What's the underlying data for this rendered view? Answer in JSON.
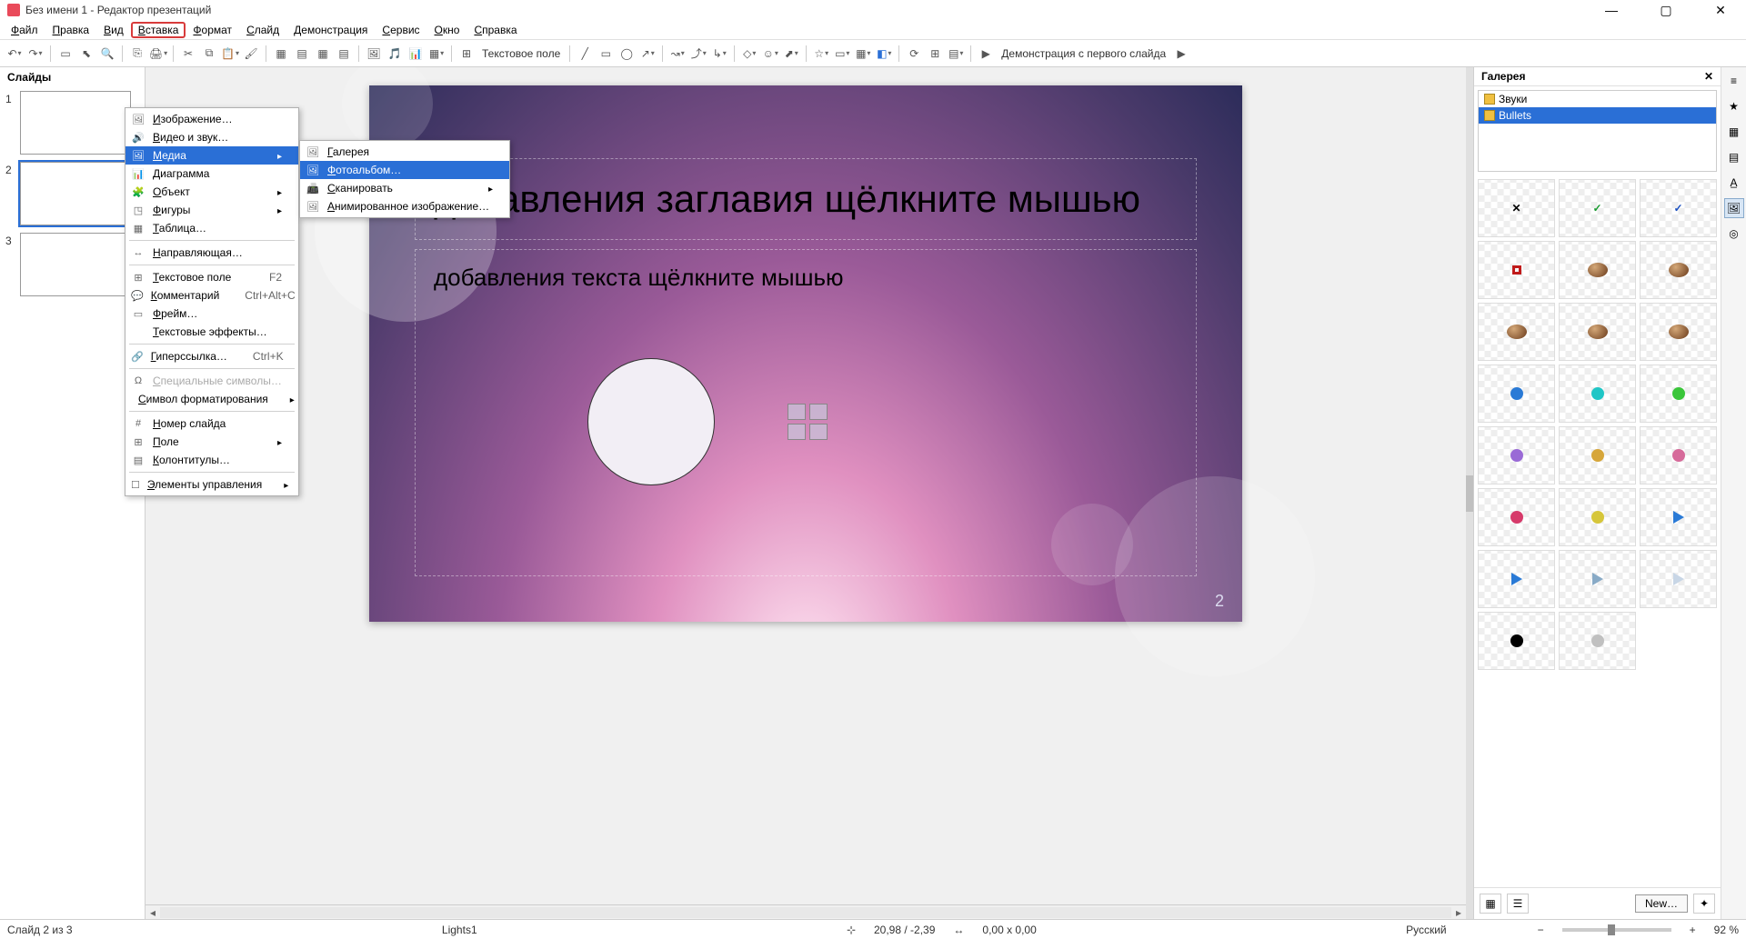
{
  "title": "Без имени 1 - Редактор презентаций",
  "menubar": [
    "Файл",
    "Правка",
    "Вид",
    "Вставка",
    "Формат",
    "Слайд",
    "Демонстрация",
    "Сервис",
    "Окно",
    "Справка"
  ],
  "menubar_highlight_index": 3,
  "toolbar": {
    "textbox_label": "Текстовое поле",
    "slideshow_label": "Демонстрация с первого слайда"
  },
  "slides_panel": {
    "title": "Слайды",
    "count": 3,
    "selected": 2
  },
  "canvas": {
    "title_placeholder": "добавления заглавия щёлкните мышью",
    "subtitle_placeholder": "добавления текста щёлкните мышью",
    "page_number": "2"
  },
  "insert_menu": [
    {
      "icon": "🖼",
      "label": "Изображение…"
    },
    {
      "icon": "🔊",
      "label": "Видео и звук…"
    },
    {
      "icon": "🖼",
      "label": "Медиа",
      "sub": true,
      "hover": true
    },
    {
      "icon": "📊",
      "label": "Диаграмма"
    },
    {
      "icon": "🧩",
      "label": "Объект",
      "sub": true
    },
    {
      "icon": "◳",
      "label": "Фигуры",
      "sub": true
    },
    {
      "icon": "▦",
      "label": "Таблица…"
    },
    {
      "sep": true
    },
    {
      "icon": "↔",
      "label": "Направляющая…"
    },
    {
      "sep": true
    },
    {
      "icon": "⊞",
      "label": "Текстовое поле",
      "accel": "F2"
    },
    {
      "icon": "💬",
      "label": "Комментарий",
      "accel": "Ctrl+Alt+C"
    },
    {
      "icon": "▭",
      "label": "Фрейм…"
    },
    {
      "icon": "",
      "label": "Текстовые эффекты…"
    },
    {
      "sep": true
    },
    {
      "icon": "🔗",
      "label": "Гиперссылка…",
      "accel": "Ctrl+K"
    },
    {
      "sep": true
    },
    {
      "icon": "Ω",
      "label": "Специальные символы…",
      "disabled": true
    },
    {
      "icon": "",
      "label": "Символ форматирования",
      "sub": true
    },
    {
      "sep": true
    },
    {
      "icon": "#",
      "label": "Номер слайда"
    },
    {
      "icon": "⊞",
      "label": "Поле",
      "sub": true
    },
    {
      "icon": "▤",
      "label": "Колонтитулы…"
    },
    {
      "sep": true
    },
    {
      "icon": "☐",
      "label": "Элементы управления",
      "sub": true
    }
  ],
  "media_submenu": [
    {
      "icon": "🖼",
      "label": "Галерея"
    },
    {
      "icon": "🖼",
      "label": "Фотоальбом…",
      "hover": true
    },
    {
      "icon": "📠",
      "label": "Сканировать",
      "sub": true
    },
    {
      "icon": "🖼",
      "label": "Анимированное изображение…"
    }
  ],
  "gallery": {
    "title": "Галерея",
    "categories": [
      "Звуки",
      "Bullets"
    ],
    "selected_category_index": 1,
    "new_button": "New…",
    "bullets_colors": [
      "#000",
      "#1a9a30",
      "#1a50c0",
      "#c01a1a",
      "#8a5a2a",
      "#1a50c0",
      "#8a5a2a",
      "#8a5a2a",
      "#8a5a2a",
      "#2a7ad6",
      "#20c6c6",
      "#3ac63a",
      "#9a6ad6",
      "#d6a63a",
      "#d66a9a",
      "#d63a6a",
      "#d6c63a",
      "#2a7ad6",
      "#2a7ad6",
      "#88aac6",
      "#c8d6e6",
      "#000",
      "#c0c0c0"
    ]
  },
  "statusbar": {
    "slide_pos": "Слайд 2 из 3",
    "template": "Lights1",
    "coords": "20,98 / -2,39",
    "size": "0,00 x 0,00",
    "language": "Русский",
    "zoom": "92 %"
  }
}
